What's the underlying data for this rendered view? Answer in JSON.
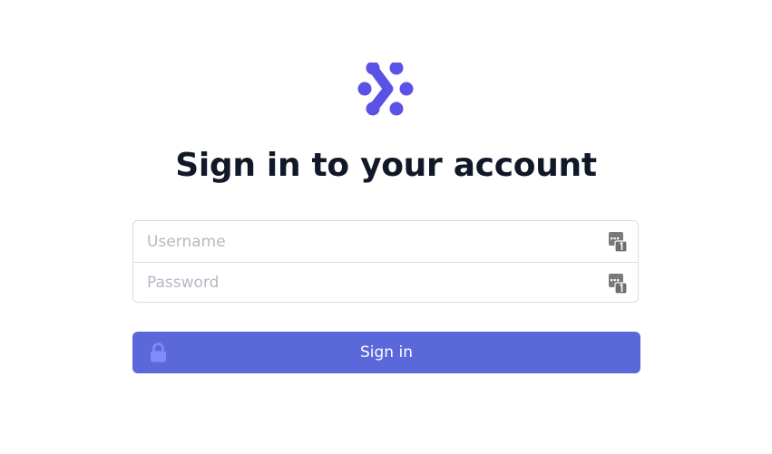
{
  "brand": {
    "logo_icon": "brand-logo-icon",
    "accent_color": "#5b5bdb"
  },
  "title": "Sign in to your account",
  "form": {
    "username": {
      "placeholder": "Username",
      "value": "",
      "icon": "password-manager-icon"
    },
    "password": {
      "placeholder": "Password",
      "value": "",
      "icon": "password-manager-icon"
    }
  },
  "submit": {
    "label": "Sign in",
    "icon": "lock-icon",
    "color": "#5b68d9"
  }
}
